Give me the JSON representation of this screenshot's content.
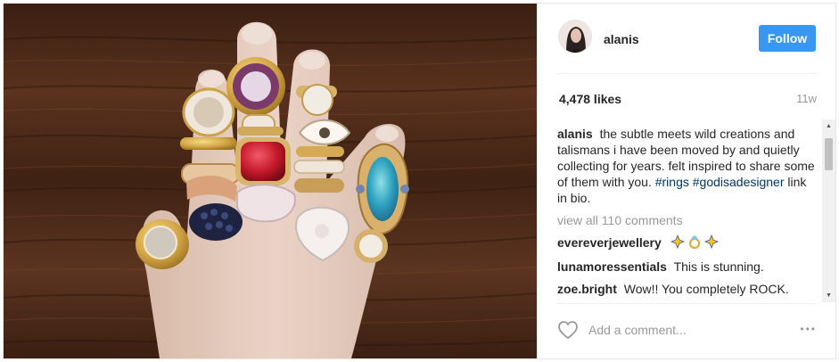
{
  "post": {
    "photo_alt": "Hand wearing many jeweled rings on a wooden table",
    "author": {
      "username": "alanis",
      "follow_label": "Follow"
    },
    "likes": "4,478 likes",
    "time_ago": "11w",
    "caption": {
      "author": "alanis",
      "text": "the subtle meets wild creations and talismans i have been moved by and quietly collecting for years. felt inspired to share some of them with you.",
      "hashtag1": "#rings",
      "hashtag2": "#godisadesigner",
      "suffix": "link in bio."
    },
    "view_all_label": "view all 110 comments",
    "comments": [
      {
        "author": "evereverjewellery",
        "text": ""
      },
      {
        "author": "lunamoressentials",
        "text": "This is stunning."
      },
      {
        "author": "zoe.bright",
        "text": "Wow!! You completely ROCK."
      }
    ],
    "add_comment_placeholder": "Add a comment...",
    "more_label": "•••"
  },
  "colors": {
    "accent": "#3897f0",
    "hashtag": "#003569",
    "muted": "#999999"
  },
  "icons": {
    "like": "heart-icon",
    "more": "more-options-icon",
    "emoji": "sparkle-ring-sparkle-emoji"
  }
}
